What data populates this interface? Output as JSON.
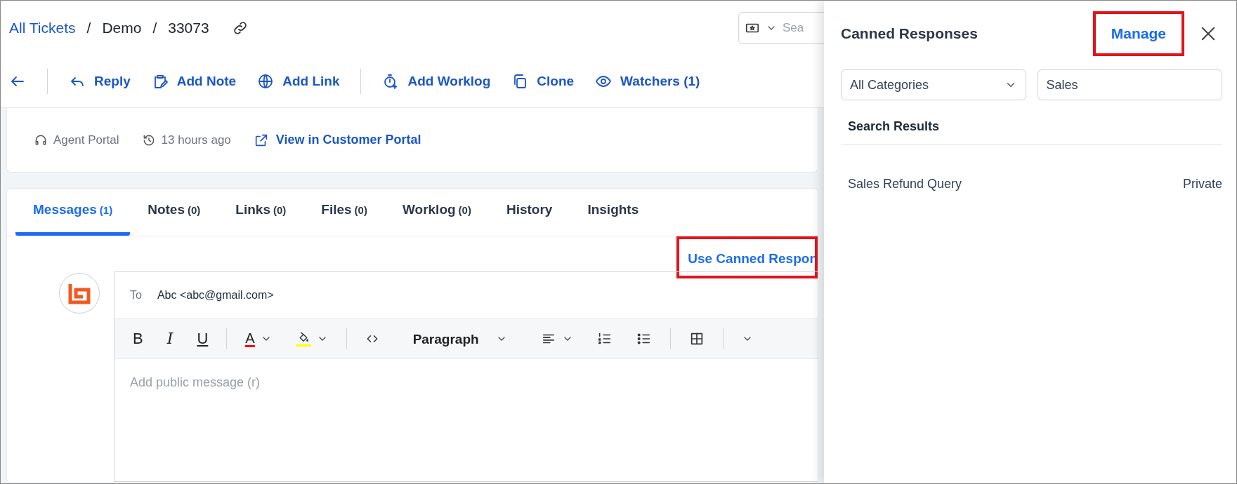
{
  "breadcrumb": [
    {
      "label": "All Tickets",
      "kind": "link"
    },
    {
      "label": "/",
      "kind": "separator"
    },
    {
      "label": "Demo",
      "kind": "text"
    },
    {
      "label": "/",
      "kind": "separator"
    },
    {
      "label": "33073",
      "kind": "text"
    }
  ],
  "header_search": {
    "placeholder": "Sea"
  },
  "actions": [
    {
      "kind": "back"
    },
    {
      "kind": "separator"
    },
    {
      "kind": "reply",
      "label": "Reply"
    },
    {
      "kind": "note",
      "label": "Add Note"
    },
    {
      "kind": "globe",
      "label": "Add Link"
    },
    {
      "kind": "separator"
    },
    {
      "kind": "timer",
      "label": "Add Worklog"
    },
    {
      "kind": "clone",
      "label": "Clone"
    },
    {
      "kind": "eye",
      "label": "Watchers (1)"
    }
  ],
  "ticket_meta": {
    "source": "Agent Portal",
    "time": "13 hours ago",
    "portal_link": "View in Customer Portal"
  },
  "tabs": [
    {
      "label": "Messages",
      "count": "(1)",
      "selected": true
    },
    {
      "label": "Notes",
      "count": "(0)",
      "selected": false
    },
    {
      "label": "Links",
      "count": "(0)",
      "selected": false
    },
    {
      "label": "Files",
      "count": "(0)",
      "selected": false
    },
    {
      "label": "Worklog",
      "count": "(0)",
      "selected": false
    },
    {
      "label": "History",
      "selected": false
    },
    {
      "label": "Insights",
      "selected": false
    }
  ],
  "canned_link": {
    "label": "Use Canned Respon",
    "highlighted": true
  },
  "composer": {
    "to_label": "To",
    "to_value": "Abc <abc@gmail.com>",
    "placeholder": "Add public message (r)",
    "toolbar": [
      {
        "kind": "bold",
        "label": "B"
      },
      {
        "kind": "italic",
        "label": "I"
      },
      {
        "kind": "underline",
        "label": "U"
      },
      {
        "kind": "separator"
      },
      {
        "kind": "font-color",
        "label": "A",
        "color": "#ff0000"
      },
      {
        "kind": "highlight",
        "color": "#ffff00"
      },
      {
        "kind": "separator"
      },
      {
        "kind": "code"
      },
      {
        "kind": "format",
        "label": "Paragraph"
      },
      {
        "kind": "align"
      },
      {
        "kind": "ordered-list"
      },
      {
        "kind": "bullet-list"
      },
      {
        "kind": "separator"
      },
      {
        "kind": "table"
      },
      {
        "kind": "separator"
      },
      {
        "kind": "more"
      }
    ]
  },
  "panel": {
    "title": "Canned Responses",
    "manage": {
      "label": "Manage",
      "highlighted": true
    },
    "category": {
      "value": "All Categories"
    },
    "search": {
      "value": "Sales"
    },
    "results_heading": "Search Results",
    "results": [
      {
        "name": "Sales Refund Query",
        "visibility": "Private"
      }
    ]
  }
}
